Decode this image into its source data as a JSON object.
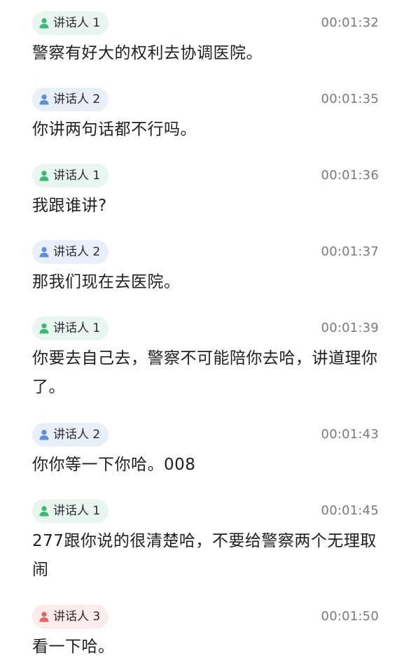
{
  "colors": {
    "speaker_1": "#3cb878",
    "speaker_2": "#5b8fd9",
    "speaker_3": "#e0675e",
    "timestamp": "#7a7a7a",
    "text": "#1f1f1f"
  },
  "icons": {
    "speaker": "person-icon"
  },
  "entries": [
    {
      "speaker": "讲话人 1",
      "time": "00:01:32",
      "text": "警察有好大的权利去协调医院。"
    },
    {
      "speaker": "讲话人 2",
      "time": "00:01:35",
      "text": "你讲两句话都不行吗。"
    },
    {
      "speaker": "讲话人 1",
      "time": "00:01:36",
      "text": "我跟谁讲?"
    },
    {
      "speaker": "讲话人 2",
      "time": "00:01:37",
      "text": "那我们现在去医院。"
    },
    {
      "speaker": "讲话人 1",
      "time": "00:01:39",
      "text": "你要去自己去，警察不可能陪你去哈，讲道理你了。"
    },
    {
      "speaker": "讲话人 2",
      "time": "00:01:43",
      "text": "你你等一下你哈。008"
    },
    {
      "speaker": "讲话人 1",
      "time": "00:01:45",
      "text": "277跟你说的很清楚哈，不要给警察两个无理取闹"
    },
    {
      "speaker": "讲话人 3",
      "time": "00:01:50",
      "text": "看一下哈。"
    }
  ]
}
